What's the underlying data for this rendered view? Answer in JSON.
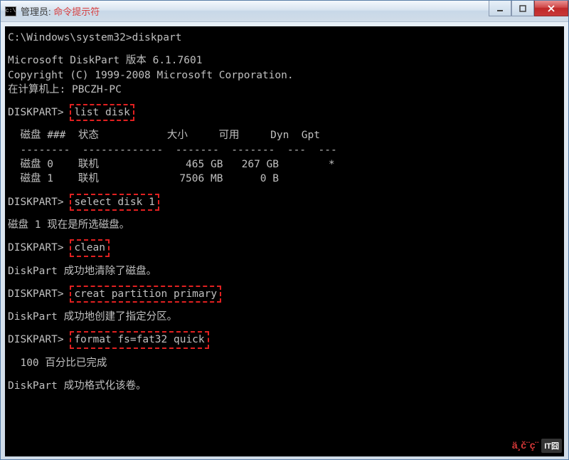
{
  "window": {
    "title_prefix": "管理员: ",
    "title_highlight": "命令提示符",
    "icon_text": "c:\\"
  },
  "terminal": {
    "prompt_initial": "C:\\Windows\\system32>diskpart",
    "header1": "Microsoft DiskPart 版本 6.1.7601",
    "header2": "Copyright (C) 1999-2008 Microsoft Corporation.",
    "header3": "在计算机上: PBCZH-PC",
    "prompt_label": "DISKPART> ",
    "cmd1": "list disk",
    "table_header": "  磁盘 ###  状态           大小     可用     Dyn  Gpt",
    "table_sep": "  --------  -------------  -------  -------  ---  ---",
    "table_row0": "  磁盘 0    联机              465 GB   267 GB        *",
    "table_row1": "  磁盘 1    联机             7506 MB      0 B",
    "cmd2": "select disk 1",
    "resp2": "磁盘 1 现在是所选磁盘。",
    "cmd3": "clean",
    "resp3": "DiskPart 成功地清除了磁盘。",
    "cmd4": "creat partition primary",
    "resp4": "DiskPart 成功地创建了指定分区。",
    "cmd5": "format fs=fat32 quick",
    "resp5a": "  100 百分比已完成",
    "resp5b": "DiskPart 成功格式化该卷。"
  },
  "watermark": {
    "text": "ä¸č¨ç¨",
    "logo": "IT囧"
  }
}
